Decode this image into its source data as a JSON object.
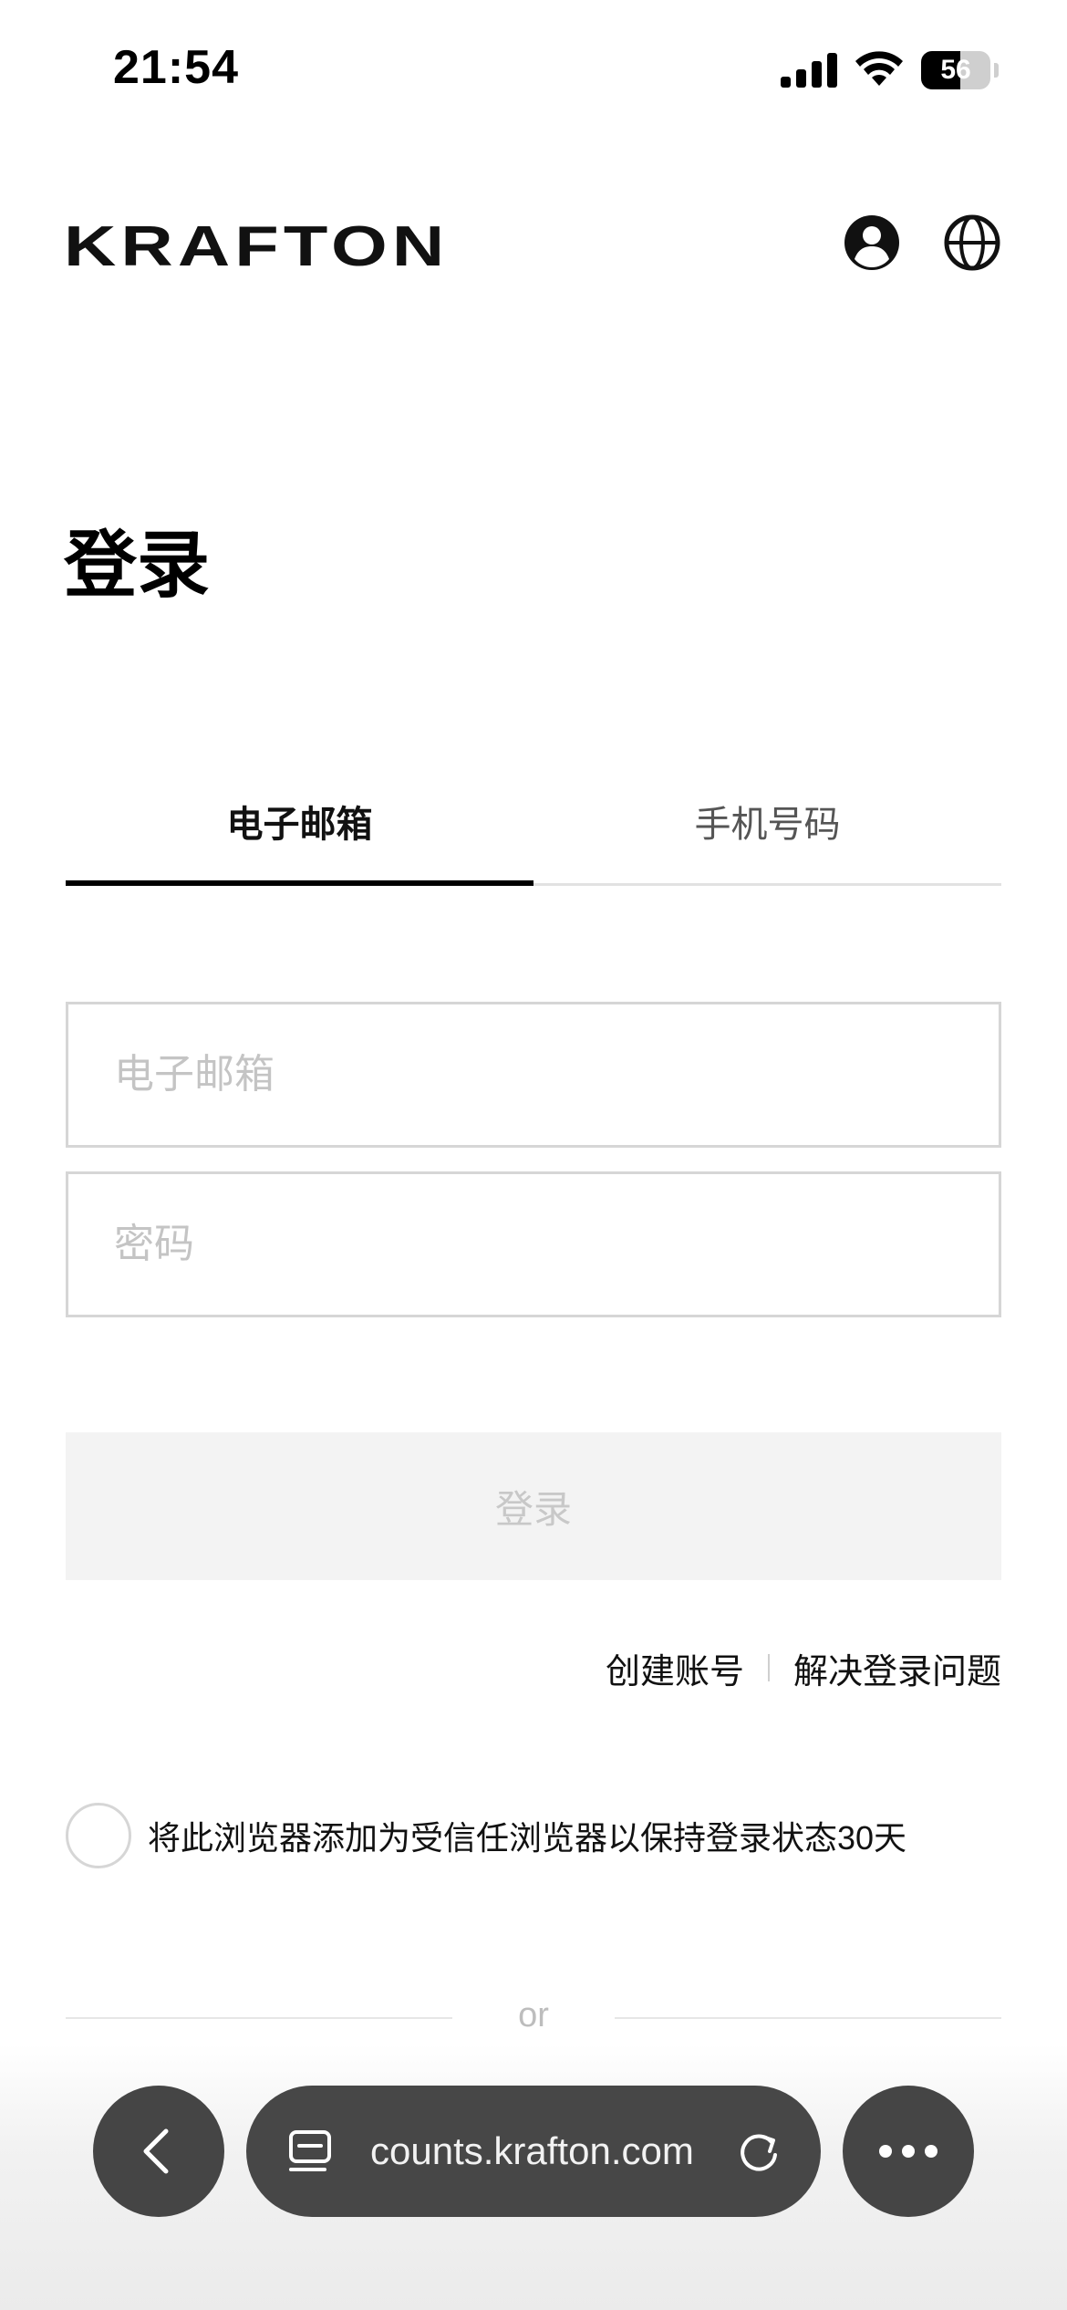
{
  "status_bar": {
    "time": "21:54",
    "battery_level": "56"
  },
  "header": {
    "logo_text": "KRAFTON",
    "icons": [
      "account-icon",
      "globe-icon"
    ]
  },
  "login": {
    "title": "登录",
    "tabs": [
      {
        "label": "电子邮箱",
        "active": true
      },
      {
        "label": "手机号码",
        "active": false
      }
    ],
    "email_placeholder": "电子邮箱",
    "password_placeholder": "密码",
    "submit_label": "登录",
    "links": {
      "create_account": "创建账号",
      "login_help": "解决登录问题"
    },
    "trust_browser_label": "将此浏览器添加为受信任浏览器以保持登录状态30天",
    "divider_text": "or"
  },
  "browser": {
    "url": "counts.krafton.com",
    "icons": [
      "back-icon",
      "tabs-icon",
      "reload-icon",
      "more-icon"
    ]
  },
  "colors": {
    "text": "#111111",
    "active_tab_indicator": "#000000",
    "field_border": "#d6d6d6",
    "button_disabled_bg": "#f3f3f3",
    "browser_bar": "#474747"
  }
}
